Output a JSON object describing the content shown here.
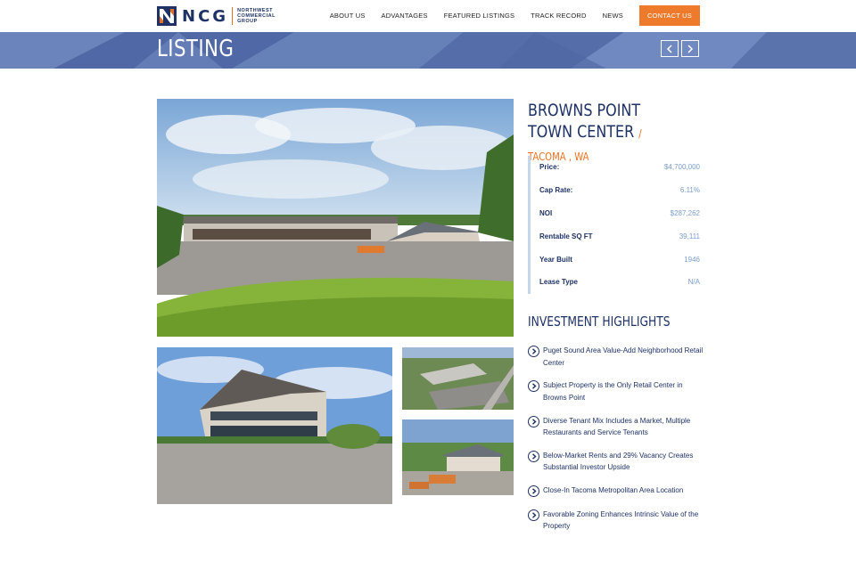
{
  "brand": {
    "letters": "NCG",
    "sub_line1": "NORTHWEST",
    "sub_line2": "COMMERCIAL",
    "sub_line3": "GROUP",
    "colors": {
      "navy": "#1e3266",
      "orange": "#e96f1e"
    }
  },
  "nav": {
    "items": [
      "ABOUT US",
      "ADVANTAGES",
      "FEATURED LISTINGS",
      "TRACK RECORD",
      "NEWS"
    ],
    "cta": "CONTACT US"
  },
  "banner": {
    "title": "LISTING",
    "prev_icon": "chevron-left-icon",
    "next_icon": "chevron-right-icon"
  },
  "property": {
    "name": "BROWNS POINT TOWN CENTER",
    "location": "/ TACOMA , WA",
    "specs": [
      {
        "label": "Price:",
        "value": "$4,700,000"
      },
      {
        "label": "Cap Rate:",
        "value": "6.11%"
      },
      {
        "label": "NOI",
        "value": "$287,262"
      },
      {
        "label": "Rentable SQ FT",
        "value": "39,111"
      },
      {
        "label": "Year Built",
        "value": "1946"
      },
      {
        "label": "Lease Type",
        "value": "N/A"
      }
    ]
  },
  "highlights": {
    "title": "INVESTMENT HIGHLIGHTS",
    "icon": "chevron-circle-right-icon",
    "items": [
      "Puget Sound Area Value-Add Neighborhood Retail Center",
      "Subject Property is the Only Retail Center in Browns Point",
      "Diverse Tenant Mix Includes a Market, Multiple Restaurants and Service Tenants",
      "Below-Market Rents and 29% Vacancy Creates Substantial Investor Upside",
      "Close-In Tacoma Metropolitan Area Location",
      "Favorable Zoning Enhances Intrinsic Value of the Property"
    ]
  }
}
